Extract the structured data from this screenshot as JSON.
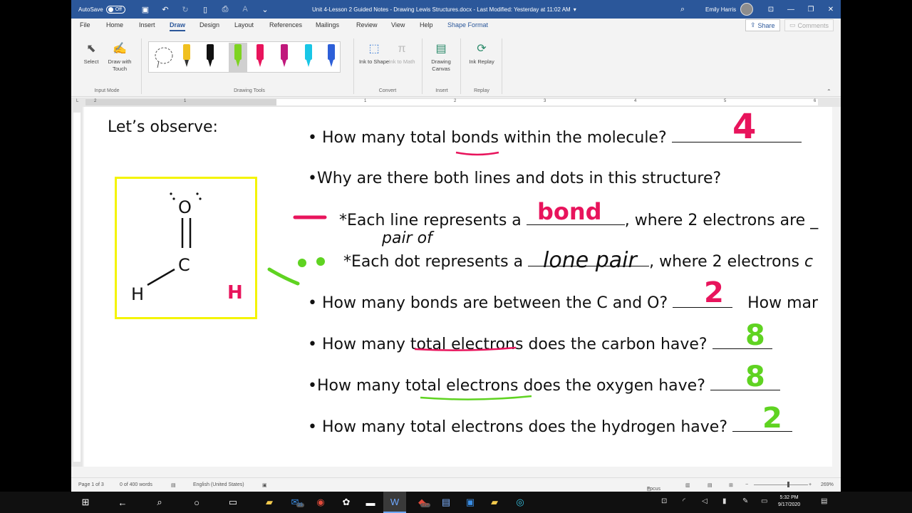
{
  "titlebar": {
    "autosave_label": "AutoSave",
    "autosave_state": "Off",
    "doc_title": "Unit 4-Lesson 2 Guided Notes - Drawing Lewis Structures.docx  -  Last Modified: Yesterday at 11:02 AM",
    "user_name": "Emily Harris"
  },
  "tabs": [
    "File",
    "Home",
    "Insert",
    "Draw",
    "Design",
    "Layout",
    "References",
    "Mailings",
    "Review",
    "View",
    "Help",
    "Shape Format"
  ],
  "share_label": "Share",
  "comments_label": "Comments",
  "ribbon": {
    "select": "Select",
    "draw_with_touch": "Draw with Touch",
    "input_mode": "Input Mode",
    "drawing_tools": "Drawing Tools",
    "ink_to_shape": "Ink to Shape",
    "ink_to_math": "Ink to Math",
    "convert": "Convert",
    "drawing_canvas": "Drawing Canvas",
    "insert": "Insert",
    "ink_replay": "Ink Replay",
    "replay": "Replay"
  },
  "pen_colors": [
    "#f0c020",
    "#111111",
    "#7ed321",
    "#e8145c",
    "#c0187c",
    "#19c6e6",
    "#2d5fd8"
  ],
  "ruler_numbers": [
    "2",
    "1",
    "1",
    "2",
    "3",
    "4",
    "5",
    "6"
  ],
  "document": {
    "lets_observe": "Let’s observe:",
    "q1": "• How many total bonds within the molecule?",
    "q1_answer": "4",
    "q2": "•Why are there both lines and dots in this structure?",
    "line_prefix": "*Each line represents a",
    "line_answer": "bond",
    "line_suffix": ", where 2 electrons are",
    "dot_prefix": "*Each dot represents a",
    "dot_answer": "lone pair",
    "dot_suffix": ", where 2 electrons",
    "pair_of_note": "pair of",
    "q3": "• How many bonds are between the C and O?",
    "q3_answer": "2",
    "q3_cont": "How mar",
    "q4": "• How many total electrons does the carbon have?",
    "q4_answer": "8",
    "q5": "•How many total electrons does the oxygen have?",
    "q5_answer": "8",
    "q6": "• How many total electrons does the hydrogen have?",
    "q6_answer": "2",
    "molecule": {
      "o": "O",
      "c": "C",
      "h_left": "H",
      "h_right": "H"
    }
  },
  "ink_colors": {
    "pink": "#e8145c",
    "green": "#5fd321"
  },
  "status": {
    "page": "Page 1 of 3",
    "words": "0 of 400 words",
    "language": "English (United States)",
    "focus": "Focus",
    "zoom": "269%"
  },
  "taskbar": {
    "time": "5:32 PM",
    "date": "9/17/2020",
    "mail_badge": "25",
    "games_badge": "99+"
  }
}
